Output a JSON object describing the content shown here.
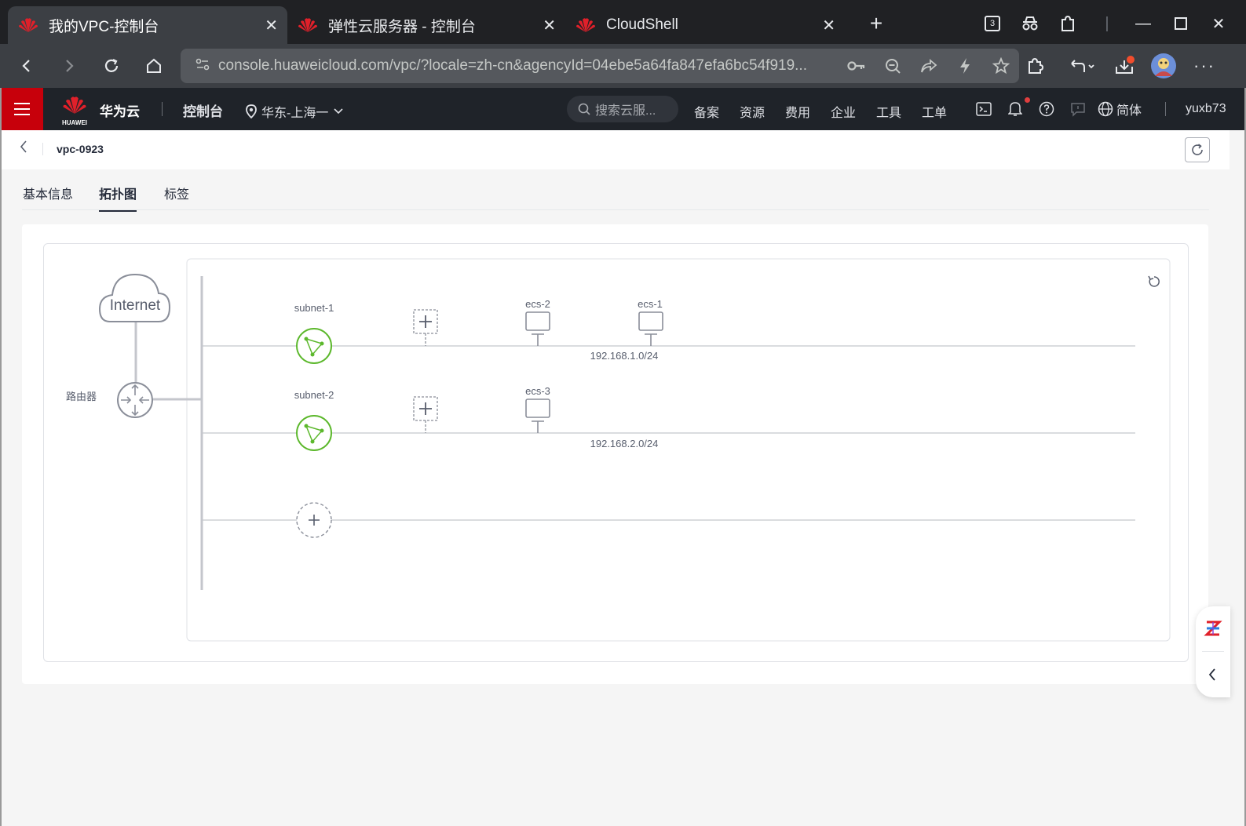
{
  "browser": {
    "tabs": [
      {
        "title": "我的VPC-控制台",
        "active": true
      },
      {
        "title": "弹性云服务器 - 控制台",
        "active": false
      },
      {
        "title": "CloudShell",
        "active": false
      }
    ],
    "new_tab_label": "+",
    "tab_count_badge": "3",
    "url": "console.huaweicloud.com/vpc/?locale=zh-cn&agencyId=04ebe5a64fa847efa6bc54f919..."
  },
  "console": {
    "logo_caption": "HUAWEI",
    "brand": "华为云",
    "title": "控制台",
    "region": "华东-上海一",
    "search_placeholder": "搜索云服...",
    "nav_links": [
      "备案",
      "资源",
      "费用",
      "企业",
      "工具",
      "工单"
    ],
    "language": "简体",
    "username": "yuxb73",
    "brand_color": "#c7000b"
  },
  "breadcrumb": {
    "title": "vpc-0923"
  },
  "tabs": [
    {
      "label": "基本信息",
      "active": false
    },
    {
      "label": "拓扑图",
      "active": true
    },
    {
      "label": "标签",
      "active": false
    }
  ],
  "topology": {
    "internet_label": "Internet",
    "router_label": "路由器",
    "subnet_color": "#5cb82c",
    "subnets": [
      {
        "name": "subnet-1",
        "cidr": "192.168.1.0/24",
        "instances": [
          "ecs-2",
          "ecs-1"
        ]
      },
      {
        "name": "subnet-2",
        "cidr": "192.168.2.0/24",
        "instances": [
          "ecs-3"
        ]
      }
    ]
  }
}
